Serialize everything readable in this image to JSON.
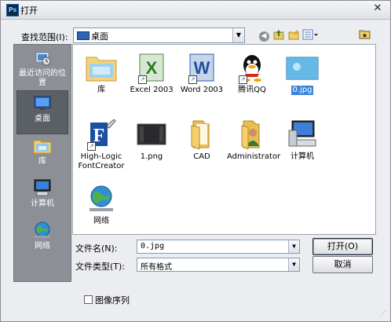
{
  "window": {
    "title": "打开",
    "app_icon": "Ps"
  },
  "toolbar": {
    "look_in_label": "查找范围(I):",
    "look_in_value": "桌面"
  },
  "places": [
    {
      "label": "最近访问的位置",
      "icon": "recent-places-icon"
    },
    {
      "label": "桌面",
      "icon": "desktop-icon",
      "selected": true
    },
    {
      "label": "库",
      "icon": "libraries-icon"
    },
    {
      "label": "计算机",
      "icon": "computer-icon"
    },
    {
      "label": "网络",
      "icon": "network-icon"
    }
  ],
  "files": [
    {
      "name": "库",
      "icon": "libraries-folder-icon"
    },
    {
      "name": "Excel 2003",
      "icon": "excel-icon",
      "shortcut": true
    },
    {
      "name": "Word 2003",
      "icon": "word-icon",
      "shortcut": true
    },
    {
      "name": "腾讯QQ",
      "icon": "qq-icon",
      "shortcut": true
    },
    {
      "name": "0.jpg",
      "icon": "image-thumbnail-icon",
      "selected": true
    },
    {
      "name": "High-Logic FontCreator",
      "icon": "fontcreator-icon",
      "shortcut": true
    },
    {
      "name": "1.png",
      "icon": "png-thumbnail-icon"
    },
    {
      "name": "CAD",
      "icon": "folder-icon"
    },
    {
      "name": "Administrator",
      "icon": "user-folder-icon"
    },
    {
      "name": "计算机",
      "icon": "computer-icon"
    },
    {
      "name": "网络",
      "icon": "network-icon"
    }
  ],
  "form": {
    "filename_label": "文件名(N):",
    "filename_value": "0.jpg",
    "filetype_label": "文件类型(T):",
    "filetype_value": "所有格式"
  },
  "buttons": {
    "open": "打开(O)",
    "cancel": "取消"
  },
  "options": {
    "image_sequence_label": "图像序列",
    "image_sequence_checked": false
  }
}
